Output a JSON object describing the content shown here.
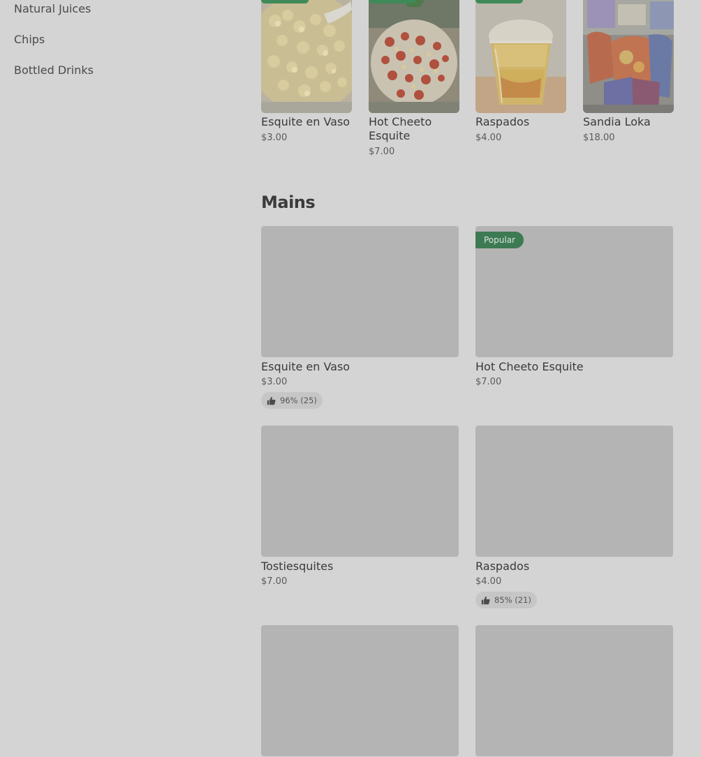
{
  "sidebar": {
    "categories": [
      {
        "label": "Natural Juices"
      },
      {
        "label": "Chips"
      },
      {
        "label": "Bottled Drinks"
      }
    ]
  },
  "featured": {
    "items": [
      {
        "name": "Esquite en Vaso",
        "price": "$3.00",
        "image": "esquite-cup-photo"
      },
      {
        "name": "Hot Cheeto Esquite",
        "price": "$7.00",
        "image": "hot-cheeto-esquite-photo"
      },
      {
        "name": "Raspados",
        "price": "$4.00",
        "image": "raspados-photo"
      },
      {
        "name": "Sandia Loka",
        "price": "$18.00",
        "image": "sandia-loka-photo"
      }
    ]
  },
  "mains": {
    "title": "Mains",
    "items": [
      {
        "name": "Esquite en Vaso",
        "price": "$3.00",
        "rating": "96% (25)",
        "badge": ""
      },
      {
        "name": "Hot Cheeto Esquite",
        "price": "$7.00",
        "rating": "",
        "badge": "Popular"
      },
      {
        "name": "Tostiesquites",
        "price": "$7.00",
        "rating": "",
        "badge": ""
      },
      {
        "name": "Raspados",
        "price": "$4.00",
        "rating": "85% (21)",
        "badge": ""
      },
      {
        "name": "",
        "price": "",
        "rating": "",
        "badge": ""
      },
      {
        "name": "",
        "price": "",
        "rating": "",
        "badge": ""
      }
    ]
  },
  "colors": {
    "overlay_background": "#d4d4d4",
    "image_placeholder": "#b4b4b4",
    "popular_badge": "#3d7a53",
    "rating_pill": "#c6c6c6"
  },
  "icons": {
    "rating": "thumbs-up-icon"
  }
}
